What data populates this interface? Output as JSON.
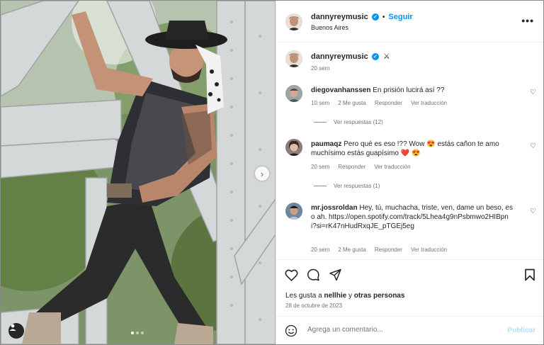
{
  "post": {
    "username": "dannyreymusic",
    "follow_label": "Seguir",
    "separator": "•",
    "location": "Buenos Aires",
    "more_label": "•••",
    "caption_emoji": "⚔",
    "caption_time": "20 sem",
    "carousel": {
      "slides": 3,
      "current": 1
    }
  },
  "comments": [
    {
      "username": "diegovanhanssen",
      "text": "En prisión lucirá así ??",
      "time": "10 sem",
      "likes": "2 Me gusta",
      "reply": "Responder",
      "translate": "Ver traducción",
      "replies_label": "Ver respuestas (12)"
    },
    {
      "username": "paumaqz",
      "text": "Pero qué es eso !?? Wow 😍 estás cañon te amo muchísimo estás guapísimo ❤️ 😍",
      "time": "20 sem",
      "likes": "",
      "reply": "Responder",
      "translate": "Ver traducción",
      "replies_label": "Ver respuestas (1)"
    },
    {
      "username": "mr.jossroldan",
      "text": "Hey, tú, muchacha, triste, ven, dame un beso, eso ah. https://open.spotify.com/track/5Lhea4g9nPsbmwo2HIBpni?si=rK47nHudRxqJE_pTGEj5eg",
      "time": "20 sem",
      "likes": "2 Me gusta",
      "reply": "Responder",
      "translate": "Ver traducción"
    }
  ],
  "likes": {
    "prefix": "Les gusta a ",
    "user": "nellhie",
    "middle": " y ",
    "others": "otras personas"
  },
  "date": "28 de octubre de 2023",
  "add_comment": {
    "placeholder": "Agrega un comentario...",
    "publish_label": "Publicar"
  },
  "colors": {
    "accent": "#0095f6",
    "publish_disabled": "#b2dffc",
    "secondary_text": "#737373",
    "heart_emoji": "#e0245e"
  }
}
